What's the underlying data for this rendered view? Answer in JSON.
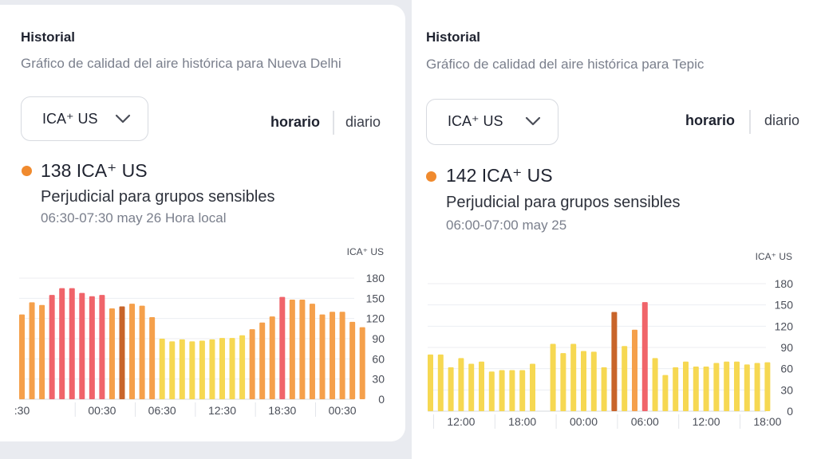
{
  "colors": {
    "yellow": "#f6d852",
    "orange": "#f5a04b",
    "red": "#f0646a",
    "darkorange": "#c8642a",
    "dot": "#f08a2e"
  },
  "icons": {
    "dropdown": "chevron-down-icon",
    "dot": "status-dot-icon"
  },
  "left": {
    "title": "Historial",
    "subtitle": "Gráfico de calidad del aire histórica para Nueva Delhi",
    "dropdown_label": "ICA⁺ US",
    "toggle_hourly": "horario",
    "toggle_daily": "diario",
    "aqi_value": "138 ICA⁺ US",
    "category": "Perjudicial para grupos sensibles",
    "timestamp": "06:30-07:30 may 26 Hora local"
  },
  "right": {
    "title": "Historial",
    "subtitle": "Gráfico de calidad del aire histórica para Tepic",
    "dropdown_label": "ICA⁺ US",
    "toggle_hourly": "horario",
    "toggle_daily": "diario",
    "aqi_value": "142 ICA⁺ US",
    "category": "Perjudicial para grupos sensibles",
    "timestamp": "06:00-07:00 may 25"
  },
  "chart_data": [
    {
      "type": "bar",
      "ylabel": "ICA⁺ US",
      "ylim": [
        0,
        180
      ],
      "yticks": [
        0,
        30,
        60,
        90,
        120,
        150,
        180
      ],
      "xtick_labels": [
        ":30",
        "00:30",
        "06:30",
        "12:30",
        "18:30",
        "00:30"
      ],
      "xtick_positions": [
        0,
        8,
        14,
        20,
        26,
        32
      ],
      "grid": true,
      "values": [
        126,
        144,
        140,
        155,
        165,
        165,
        158,
        153,
        155,
        135,
        138,
        142,
        139,
        122,
        90,
        86,
        89,
        86,
        87,
        89,
        91,
        91,
        95,
        104,
        114,
        123,
        152,
        148,
        148,
        142,
        126,
        130,
        130,
        115,
        107
      ],
      "colors": [
        "orange",
        "orange",
        "orange",
        "red",
        "red",
        "red",
        "red",
        "red",
        "red",
        "orange",
        "darkorange",
        "orange",
        "orange",
        "orange",
        "yellow",
        "yellow",
        "yellow",
        "yellow",
        "yellow",
        "yellow",
        "yellow",
        "yellow",
        "yellow",
        "orange",
        "orange",
        "orange",
        "red",
        "orange",
        "orange",
        "orange",
        "orange",
        "orange",
        "orange",
        "orange",
        "orange"
      ]
    },
    {
      "type": "bar",
      "ylabel": "ICA⁺ US",
      "ylim": [
        0,
        180
      ],
      "yticks": [
        0,
        30,
        60,
        90,
        120,
        150,
        180
      ],
      "xtick_labels": [
        "12:00",
        "18:00",
        "00:00",
        "06:00",
        "12:00",
        "18:00"
      ],
      "xtick_positions": [
        3,
        9,
        15,
        21,
        27,
        33
      ],
      "grid": true,
      "values": [
        80,
        80,
        62,
        75,
        67,
        70,
        56,
        58,
        58,
        58,
        67,
        null,
        95,
        82,
        95,
        85,
        84,
        62,
        140,
        92,
        115,
        154,
        75,
        51,
        62,
        70,
        63,
        63,
        68,
        70,
        70,
        66,
        68,
        69
      ],
      "colors": [
        "yellow",
        "yellow",
        "yellow",
        "yellow",
        "yellow",
        "yellow",
        "yellow",
        "yellow",
        "yellow",
        "yellow",
        "yellow",
        "yellow",
        "yellow",
        "yellow",
        "yellow",
        "yellow",
        "yellow",
        "yellow",
        "darkorange",
        "yellow",
        "orange",
        "red",
        "yellow",
        "yellow",
        "yellow",
        "yellow",
        "yellow",
        "yellow",
        "yellow",
        "yellow",
        "yellow",
        "yellow",
        "yellow",
        "yellow"
      ]
    }
  ]
}
